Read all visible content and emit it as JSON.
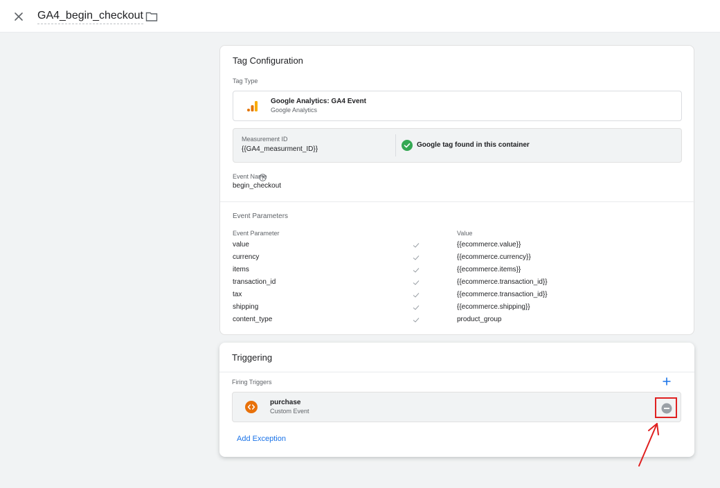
{
  "header": {
    "tag_name": "GA4_begin_checkout",
    "close_icon": "close-icon",
    "folder_icon": "folder-icon"
  },
  "config": {
    "title": "Tag Configuration",
    "tag_type_label": "Tag Type",
    "tag_type_name": "Google Analytics: GA4 Event",
    "tag_type_sub": "Google Analytics",
    "measurement_label": "Measurement ID",
    "measurement_value": "{{GA4_measurment_ID}}",
    "google_tag_status": "Google tag found in this container",
    "event_name_label": "Event Name",
    "event_name_value": "begin_checkout",
    "params_title": "Event Parameters",
    "param_col_left": "Event Parameter",
    "param_col_right": "Value",
    "params": [
      {
        "name": "value",
        "value": "{{ecommerce.value}}"
      },
      {
        "name": "currency",
        "value": "{{ecommerce.currency}}"
      },
      {
        "name": "items",
        "value": "{{ecommerce.items}}"
      },
      {
        "name": "transaction_id",
        "value": "{{ecommerce.transaction_id}}"
      },
      {
        "name": "tax",
        "value": "{{ecommerce.transaction_id}}"
      },
      {
        "name": "shipping",
        "value": "{{ecommerce.shipping}}"
      },
      {
        "name": "content_type",
        "value": "product_group"
      }
    ]
  },
  "triggering": {
    "title": "Triggering",
    "firing_label": "Firing Triggers",
    "trigger_name": "purchase",
    "trigger_type": "Custom Event",
    "add_exception": "Add Exception"
  },
  "colors": {
    "accent": "#1a73e8",
    "success": "#34a853",
    "trigger_orange": "#e8710a",
    "highlight": "#e02020"
  }
}
